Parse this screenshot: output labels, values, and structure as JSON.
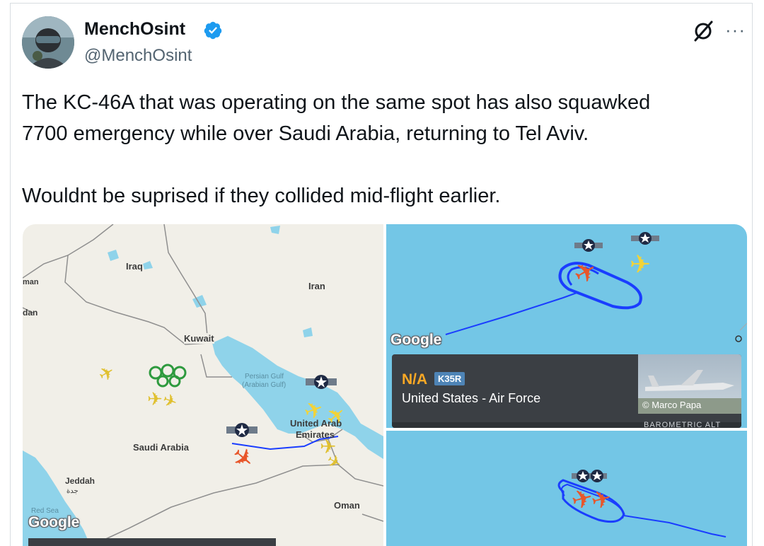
{
  "tweet": {
    "author_name": "MenchOsint",
    "author_handle": "@MenchOsint",
    "text_line1": "The KC-46A that was operating on the same spot has also squawked",
    "text_line2": "7700 emergency while over Saudi Arabia, returning to Tel Aviv.",
    "text_line3": "Wouldnt be suprised if they collided mid-flight earlier.",
    "icons": [
      "verified-badge-icon",
      "grok-icon",
      "more-options-icon"
    ]
  },
  "map_left": {
    "labels": {
      "iraq": "Iraq",
      "iran": "Iran",
      "kuwait": "Kuwait",
      "persian_gulf": "Persian Gulf",
      "arabian_gulf": "(Arabian Gulf)",
      "saudi": "Saudi Arabia",
      "uae_1": "United Arab",
      "uae_2": "Emirates",
      "jeddah": "Jeddah",
      "jeddah_ar": "جدة",
      "oman": "Oman",
      "red_sea": "Red Sea",
      "oman_cut": "man",
      "dan_cut": "dan",
      "google": "Google"
    }
  },
  "map_right_top": {
    "google": "Google",
    "callsign": "N/A",
    "aircraft_type": "K35R",
    "operator": "United States - Air Force",
    "photo_credit": "© Marco Papa",
    "baro_label": "BAROMETRIC ALT"
  },
  "colors": {
    "map_land": "#f1efe8",
    "water": "#8fd3ea",
    "ocean": "#73c6e6",
    "track_blue": "#1a3dff",
    "plane_orange": "#e8562a",
    "plane_yellow": "#f2d338",
    "verified_blue": "#1d9bf0"
  }
}
